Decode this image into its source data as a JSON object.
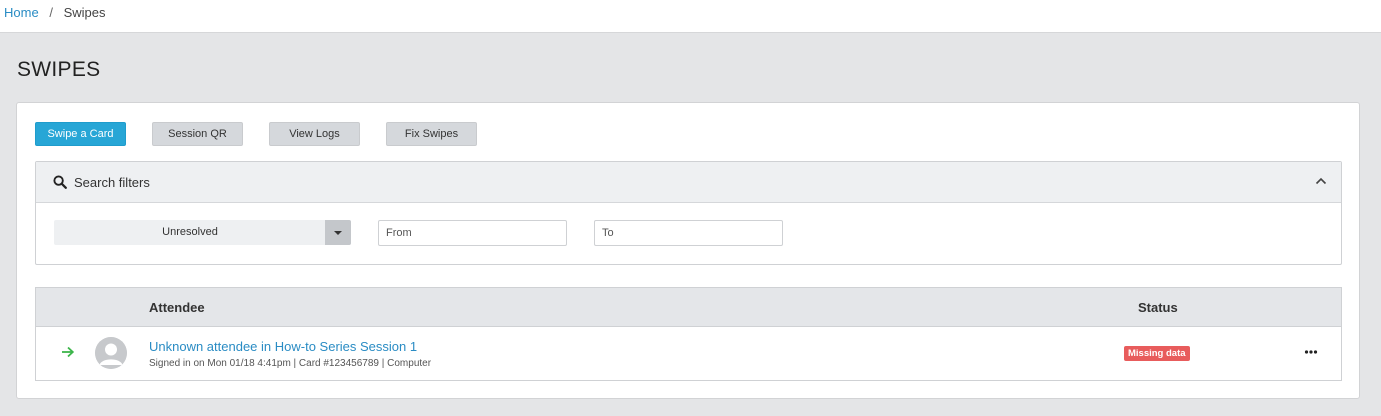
{
  "breadcrumb": {
    "home": "Home",
    "separator": "/",
    "current": "Swipes"
  },
  "page": {
    "title": "SWIPES"
  },
  "actions": {
    "swipe_card": "Swipe a Card",
    "session_qr": "Session QR",
    "view_logs": "View Logs",
    "fix_swipes": "Fix Swipes"
  },
  "filters": {
    "title": "Search filters",
    "status_value": "Unresolved",
    "from_placeholder": "From",
    "to_placeholder": "To"
  },
  "table": {
    "columns": {
      "attendee": "Attendee",
      "status": "Status"
    },
    "rows": [
      {
        "name": "Unknown attendee in How-to Series Session 1",
        "details": "Signed in on Mon 01/18 4:41pm | Card #123456789 | Computer",
        "status": "Missing data"
      }
    ]
  },
  "colors": {
    "primary": "#27a6d6",
    "link": "#2a8cc4",
    "danger_badge": "#e85c5c",
    "success_arrow": "#3cb54a"
  },
  "icons": [
    "search-icon",
    "chevron-up-icon",
    "caret-down-icon",
    "arrow-right-icon",
    "avatar-placeholder-icon",
    "more-horizontal-icon"
  ]
}
